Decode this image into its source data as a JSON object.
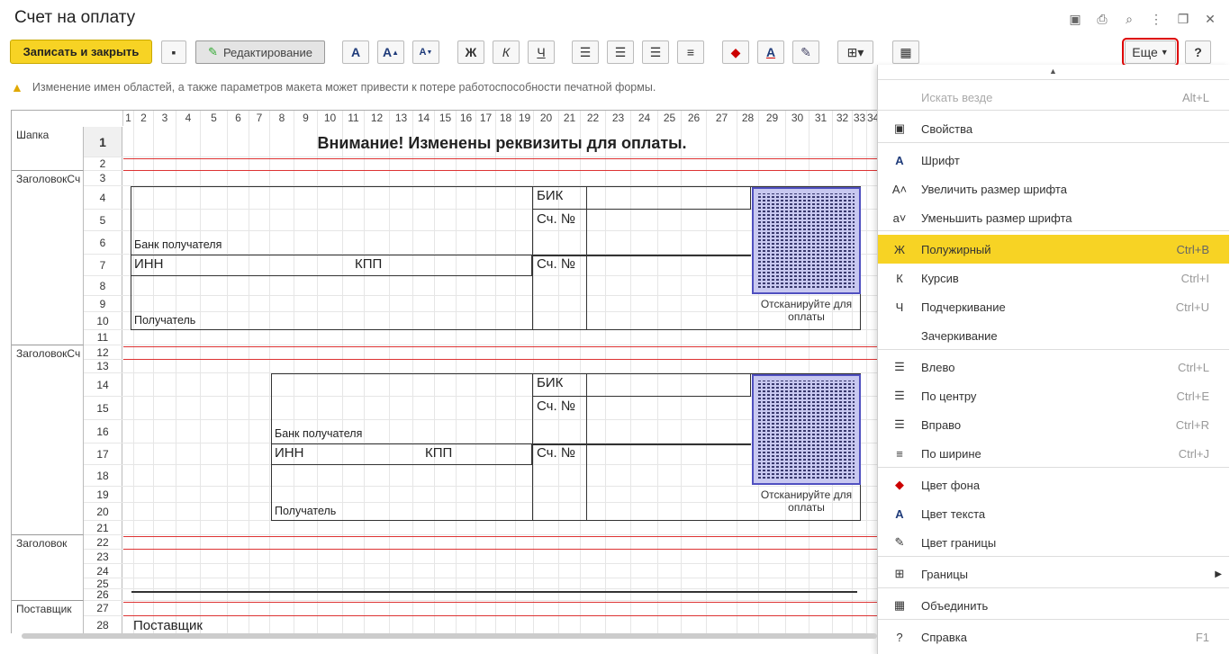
{
  "window": {
    "title": "Счет на оплату"
  },
  "toolbar": {
    "save_close": "Записать и закрыть",
    "edit_mode": "Редактирование",
    "bold": "Ж",
    "italic": "К",
    "underline": "Ч",
    "more": "Еще",
    "help": "?"
  },
  "warning": "Изменение имен областей, а также параметров макета может привести к потере работоспособности печатной формы.",
  "columns": [
    "1",
    "2",
    "3",
    "4",
    "5",
    "6",
    "7",
    "8",
    "9",
    "10",
    "11",
    "12",
    "13",
    "14",
    "15",
    "16",
    "17",
    "18",
    "19",
    "20",
    "21",
    "22",
    "23",
    "24",
    "25",
    "26",
    "27",
    "28",
    "29",
    "30",
    "31",
    "32",
    "33",
    "34"
  ],
  "rows": [
    "1",
    "2",
    "3",
    "4",
    "5",
    "6",
    "7",
    "8",
    "9",
    "10",
    "11",
    "12",
    "13",
    "14",
    "15",
    "16",
    "17",
    "18",
    "19",
    "20",
    "21",
    "22",
    "23",
    "24",
    "25",
    "26",
    "27",
    "28"
  ],
  "areas": [
    "Шапка",
    "ЗаголовокСч",
    "ЗаголовокСч",
    "Заголовок",
    "Поставщик"
  ],
  "sheet": {
    "heading": "Внимание! Изменены реквизиты для оплаты.",
    "bik": "БИК",
    "acc_no": "Сч. №",
    "bank": "Банк получателя",
    "inn": "ИНН",
    "kpp": "КПП",
    "recipient": "Получатель",
    "scan": "Отсканируйте для оплаты",
    "supplier": "Поставщик"
  },
  "menu": {
    "items": [
      {
        "label": "Искать везде",
        "shortcut": "Alt+L",
        "icon": "search-icon"
      },
      {
        "label": "Свойства",
        "shortcut": "",
        "icon": "properties-icon"
      },
      {
        "label": "Шрифт",
        "shortcut": "",
        "icon": "font-icon"
      },
      {
        "label": "Увеличить размер шрифта",
        "shortcut": "",
        "icon": "font-increase-icon"
      },
      {
        "label": "Уменьшить размер шрифта",
        "shortcut": "",
        "icon": "font-decrease-icon"
      },
      {
        "label": "Полужирный",
        "shortcut": "Ctrl+B",
        "icon": "bold-icon"
      },
      {
        "label": "Курсив",
        "shortcut": "Ctrl+I",
        "icon": "italic-icon"
      },
      {
        "label": "Подчеркивание",
        "shortcut": "Ctrl+U",
        "icon": "underline-icon"
      },
      {
        "label": "Зачеркивание",
        "shortcut": "",
        "icon": "strikethrough-icon"
      },
      {
        "label": "Влево",
        "shortcut": "Ctrl+L",
        "icon": "align-left-icon"
      },
      {
        "label": "По центру",
        "shortcut": "Ctrl+E",
        "icon": "align-center-icon"
      },
      {
        "label": "Вправо",
        "shortcut": "Ctrl+R",
        "icon": "align-right-icon"
      },
      {
        "label": "По ширине",
        "shortcut": "Ctrl+J",
        "icon": "align-justify-icon"
      },
      {
        "label": "Цвет фона",
        "shortcut": "",
        "icon": "background-color-icon"
      },
      {
        "label": "Цвет текста",
        "shortcut": "",
        "icon": "text-color-icon"
      },
      {
        "label": "Цвет границы",
        "shortcut": "",
        "icon": "border-color-icon"
      },
      {
        "label": "Границы",
        "shortcut": "",
        "icon": "borders-icon"
      },
      {
        "label": "Объединить",
        "shortcut": "",
        "icon": "merge-icon"
      },
      {
        "label": "Справка",
        "shortcut": "F1",
        "icon": "help-icon"
      }
    ]
  }
}
